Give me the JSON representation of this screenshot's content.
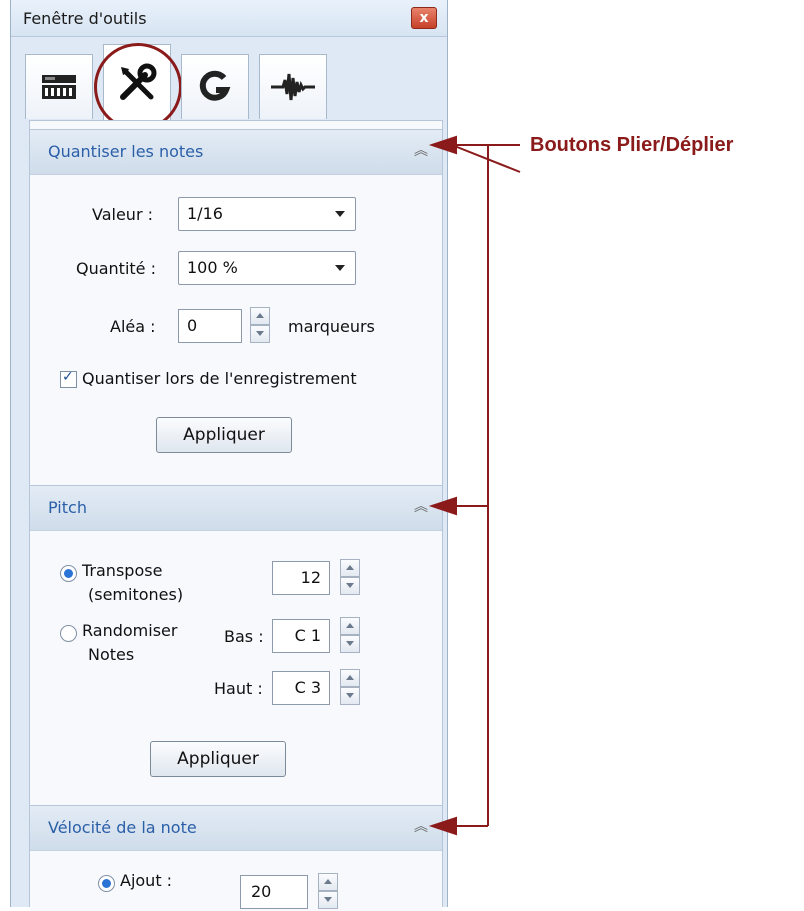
{
  "window": {
    "title": "Fenêtre d'outils",
    "close_label": "x"
  },
  "tabs": [
    {
      "icon": "keyboard-icon"
    },
    {
      "icon": "tools-icon",
      "active": true
    },
    {
      "icon": "g-icon"
    },
    {
      "icon": "waveform-icon"
    }
  ],
  "annotation": {
    "label": "Boutons Plier/Déplier",
    "color": "#8b1a1a"
  },
  "sections": {
    "quantize": {
      "title": "Quantiser les notes",
      "valeur_label": "Valeur :",
      "valeur_value": "1/16",
      "quantite_label": "Quantité :",
      "quantite_value": "100 %",
      "alea_label": "Aléa :",
      "alea_value": "0",
      "alea_unit": "marqueurs",
      "record_checkbox_label": "Quantiser lors de l'enregistrement",
      "apply_label": "Appliquer"
    },
    "pitch": {
      "title": "Pitch",
      "transpose_line1": "Transpose",
      "transpose_line2": "(semitones)",
      "transpose_value": "12",
      "random_line1": "Randomiser",
      "random_line2": "Notes",
      "bas_label": "Bas :",
      "bas_value": "C 1",
      "haut_label": "Haut :",
      "haut_value": "C 3",
      "apply_label": "Appliquer"
    },
    "velocity": {
      "title": "Vélocité de la note",
      "ajout_label": "Ajout :",
      "ajout_value": "20"
    }
  },
  "colors": {
    "header_text": "#2a5fa8",
    "annotation": "#8b1a1a",
    "window_bg": "#dfe9f5"
  }
}
